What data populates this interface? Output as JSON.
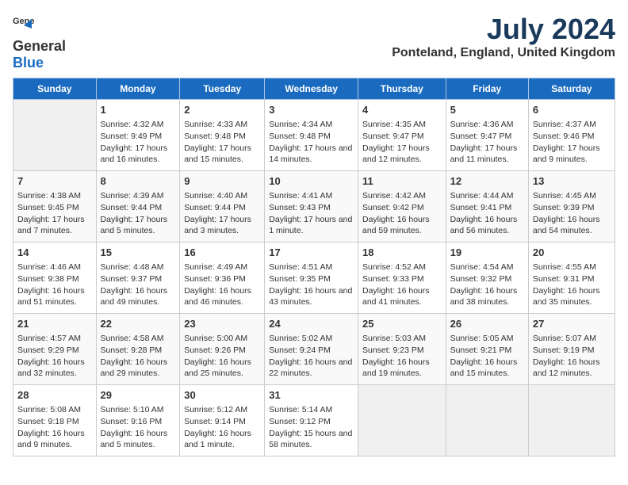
{
  "logo": {
    "general": "General",
    "blue": "Blue"
  },
  "title": "July 2024",
  "subtitle": "Ponteland, England, United Kingdom",
  "days_of_week": [
    "Sunday",
    "Monday",
    "Tuesday",
    "Wednesday",
    "Thursday",
    "Friday",
    "Saturday"
  ],
  "weeks": [
    [
      {
        "day": "",
        "content": ""
      },
      {
        "day": "1",
        "content": "Sunrise: 4:32 AM\nSunset: 9:49 PM\nDaylight: 17 hours and 16 minutes."
      },
      {
        "day": "2",
        "content": "Sunrise: 4:33 AM\nSunset: 9:48 PM\nDaylight: 17 hours and 15 minutes."
      },
      {
        "day": "3",
        "content": "Sunrise: 4:34 AM\nSunset: 9:48 PM\nDaylight: 17 hours and 14 minutes."
      },
      {
        "day": "4",
        "content": "Sunrise: 4:35 AM\nSunset: 9:47 PM\nDaylight: 17 hours and 12 minutes."
      },
      {
        "day": "5",
        "content": "Sunrise: 4:36 AM\nSunset: 9:47 PM\nDaylight: 17 hours and 11 minutes."
      },
      {
        "day": "6",
        "content": "Sunrise: 4:37 AM\nSunset: 9:46 PM\nDaylight: 17 hours and 9 minutes."
      }
    ],
    [
      {
        "day": "7",
        "content": "Sunrise: 4:38 AM\nSunset: 9:45 PM\nDaylight: 17 hours and 7 minutes."
      },
      {
        "day": "8",
        "content": "Sunrise: 4:39 AM\nSunset: 9:44 PM\nDaylight: 17 hours and 5 minutes."
      },
      {
        "day": "9",
        "content": "Sunrise: 4:40 AM\nSunset: 9:44 PM\nDaylight: 17 hours and 3 minutes."
      },
      {
        "day": "10",
        "content": "Sunrise: 4:41 AM\nSunset: 9:43 PM\nDaylight: 17 hours and 1 minute."
      },
      {
        "day": "11",
        "content": "Sunrise: 4:42 AM\nSunset: 9:42 PM\nDaylight: 16 hours and 59 minutes."
      },
      {
        "day": "12",
        "content": "Sunrise: 4:44 AM\nSunset: 9:41 PM\nDaylight: 16 hours and 56 minutes."
      },
      {
        "day": "13",
        "content": "Sunrise: 4:45 AM\nSunset: 9:39 PM\nDaylight: 16 hours and 54 minutes."
      }
    ],
    [
      {
        "day": "14",
        "content": "Sunrise: 4:46 AM\nSunset: 9:38 PM\nDaylight: 16 hours and 51 minutes."
      },
      {
        "day": "15",
        "content": "Sunrise: 4:48 AM\nSunset: 9:37 PM\nDaylight: 16 hours and 49 minutes."
      },
      {
        "day": "16",
        "content": "Sunrise: 4:49 AM\nSunset: 9:36 PM\nDaylight: 16 hours and 46 minutes."
      },
      {
        "day": "17",
        "content": "Sunrise: 4:51 AM\nSunset: 9:35 PM\nDaylight: 16 hours and 43 minutes."
      },
      {
        "day": "18",
        "content": "Sunrise: 4:52 AM\nSunset: 9:33 PM\nDaylight: 16 hours and 41 minutes."
      },
      {
        "day": "19",
        "content": "Sunrise: 4:54 AM\nSunset: 9:32 PM\nDaylight: 16 hours and 38 minutes."
      },
      {
        "day": "20",
        "content": "Sunrise: 4:55 AM\nSunset: 9:31 PM\nDaylight: 16 hours and 35 minutes."
      }
    ],
    [
      {
        "day": "21",
        "content": "Sunrise: 4:57 AM\nSunset: 9:29 PM\nDaylight: 16 hours and 32 minutes."
      },
      {
        "day": "22",
        "content": "Sunrise: 4:58 AM\nSunset: 9:28 PM\nDaylight: 16 hours and 29 minutes."
      },
      {
        "day": "23",
        "content": "Sunrise: 5:00 AM\nSunset: 9:26 PM\nDaylight: 16 hours and 25 minutes."
      },
      {
        "day": "24",
        "content": "Sunrise: 5:02 AM\nSunset: 9:24 PM\nDaylight: 16 hours and 22 minutes."
      },
      {
        "day": "25",
        "content": "Sunrise: 5:03 AM\nSunset: 9:23 PM\nDaylight: 16 hours and 19 minutes."
      },
      {
        "day": "26",
        "content": "Sunrise: 5:05 AM\nSunset: 9:21 PM\nDaylight: 16 hours and 15 minutes."
      },
      {
        "day": "27",
        "content": "Sunrise: 5:07 AM\nSunset: 9:19 PM\nDaylight: 16 hours and 12 minutes."
      }
    ],
    [
      {
        "day": "28",
        "content": "Sunrise: 5:08 AM\nSunset: 9:18 PM\nDaylight: 16 hours and 9 minutes."
      },
      {
        "day": "29",
        "content": "Sunrise: 5:10 AM\nSunset: 9:16 PM\nDaylight: 16 hours and 5 minutes."
      },
      {
        "day": "30",
        "content": "Sunrise: 5:12 AM\nSunset: 9:14 PM\nDaylight: 16 hours and 1 minute."
      },
      {
        "day": "31",
        "content": "Sunrise: 5:14 AM\nSunset: 9:12 PM\nDaylight: 15 hours and 58 minutes."
      },
      {
        "day": "",
        "content": ""
      },
      {
        "day": "",
        "content": ""
      },
      {
        "day": "",
        "content": ""
      }
    ]
  ]
}
